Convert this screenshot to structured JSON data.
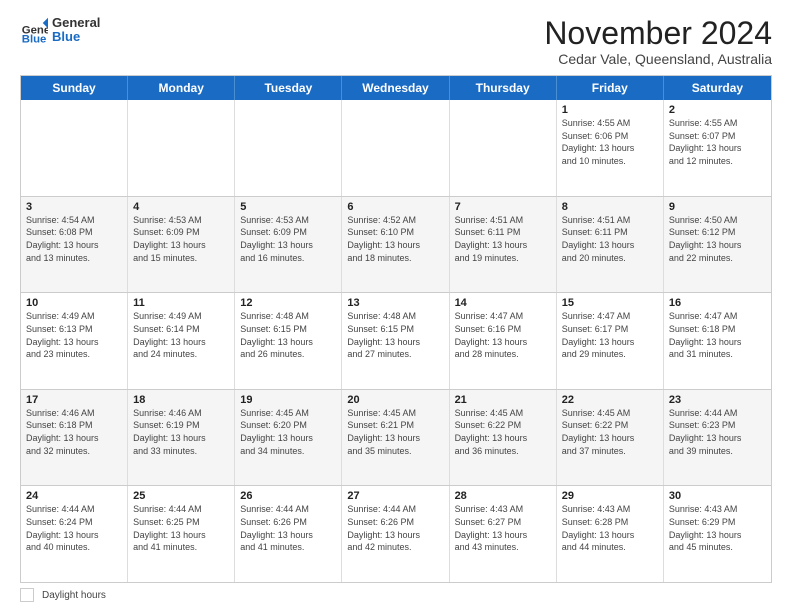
{
  "header": {
    "logo_general": "General",
    "logo_blue": "Blue",
    "title": "November 2024",
    "subtitle": "Cedar Vale, Queensland, Australia"
  },
  "calendar": {
    "days_of_week": [
      "Sunday",
      "Monday",
      "Tuesday",
      "Wednesday",
      "Thursday",
      "Friday",
      "Saturday"
    ],
    "rows": [
      {
        "alt": false,
        "cells": [
          {
            "day": "",
            "info": ""
          },
          {
            "day": "",
            "info": ""
          },
          {
            "day": "",
            "info": ""
          },
          {
            "day": "",
            "info": ""
          },
          {
            "day": "",
            "info": ""
          },
          {
            "day": "1",
            "info": "Sunrise: 4:55 AM\nSunset: 6:06 PM\nDaylight: 13 hours\nand 10 minutes."
          },
          {
            "day": "2",
            "info": "Sunrise: 4:55 AM\nSunset: 6:07 PM\nDaylight: 13 hours\nand 12 minutes."
          }
        ]
      },
      {
        "alt": true,
        "cells": [
          {
            "day": "3",
            "info": "Sunrise: 4:54 AM\nSunset: 6:08 PM\nDaylight: 13 hours\nand 13 minutes."
          },
          {
            "day": "4",
            "info": "Sunrise: 4:53 AM\nSunset: 6:09 PM\nDaylight: 13 hours\nand 15 minutes."
          },
          {
            "day": "5",
            "info": "Sunrise: 4:53 AM\nSunset: 6:09 PM\nDaylight: 13 hours\nand 16 minutes."
          },
          {
            "day": "6",
            "info": "Sunrise: 4:52 AM\nSunset: 6:10 PM\nDaylight: 13 hours\nand 18 minutes."
          },
          {
            "day": "7",
            "info": "Sunrise: 4:51 AM\nSunset: 6:11 PM\nDaylight: 13 hours\nand 19 minutes."
          },
          {
            "day": "8",
            "info": "Sunrise: 4:51 AM\nSunset: 6:11 PM\nDaylight: 13 hours\nand 20 minutes."
          },
          {
            "day": "9",
            "info": "Sunrise: 4:50 AM\nSunset: 6:12 PM\nDaylight: 13 hours\nand 22 minutes."
          }
        ]
      },
      {
        "alt": false,
        "cells": [
          {
            "day": "10",
            "info": "Sunrise: 4:49 AM\nSunset: 6:13 PM\nDaylight: 13 hours\nand 23 minutes."
          },
          {
            "day": "11",
            "info": "Sunrise: 4:49 AM\nSunset: 6:14 PM\nDaylight: 13 hours\nand 24 minutes."
          },
          {
            "day": "12",
            "info": "Sunrise: 4:48 AM\nSunset: 6:15 PM\nDaylight: 13 hours\nand 26 minutes."
          },
          {
            "day": "13",
            "info": "Sunrise: 4:48 AM\nSunset: 6:15 PM\nDaylight: 13 hours\nand 27 minutes."
          },
          {
            "day": "14",
            "info": "Sunrise: 4:47 AM\nSunset: 6:16 PM\nDaylight: 13 hours\nand 28 minutes."
          },
          {
            "day": "15",
            "info": "Sunrise: 4:47 AM\nSunset: 6:17 PM\nDaylight: 13 hours\nand 29 minutes."
          },
          {
            "day": "16",
            "info": "Sunrise: 4:47 AM\nSunset: 6:18 PM\nDaylight: 13 hours\nand 31 minutes."
          }
        ]
      },
      {
        "alt": true,
        "cells": [
          {
            "day": "17",
            "info": "Sunrise: 4:46 AM\nSunset: 6:18 PM\nDaylight: 13 hours\nand 32 minutes."
          },
          {
            "day": "18",
            "info": "Sunrise: 4:46 AM\nSunset: 6:19 PM\nDaylight: 13 hours\nand 33 minutes."
          },
          {
            "day": "19",
            "info": "Sunrise: 4:45 AM\nSunset: 6:20 PM\nDaylight: 13 hours\nand 34 minutes."
          },
          {
            "day": "20",
            "info": "Sunrise: 4:45 AM\nSunset: 6:21 PM\nDaylight: 13 hours\nand 35 minutes."
          },
          {
            "day": "21",
            "info": "Sunrise: 4:45 AM\nSunset: 6:22 PM\nDaylight: 13 hours\nand 36 minutes."
          },
          {
            "day": "22",
            "info": "Sunrise: 4:45 AM\nSunset: 6:22 PM\nDaylight: 13 hours\nand 37 minutes."
          },
          {
            "day": "23",
            "info": "Sunrise: 4:44 AM\nSunset: 6:23 PM\nDaylight: 13 hours\nand 39 minutes."
          }
        ]
      },
      {
        "alt": false,
        "cells": [
          {
            "day": "24",
            "info": "Sunrise: 4:44 AM\nSunset: 6:24 PM\nDaylight: 13 hours\nand 40 minutes."
          },
          {
            "day": "25",
            "info": "Sunrise: 4:44 AM\nSunset: 6:25 PM\nDaylight: 13 hours\nand 41 minutes."
          },
          {
            "day": "26",
            "info": "Sunrise: 4:44 AM\nSunset: 6:26 PM\nDaylight: 13 hours\nand 41 minutes."
          },
          {
            "day": "27",
            "info": "Sunrise: 4:44 AM\nSunset: 6:26 PM\nDaylight: 13 hours\nand 42 minutes."
          },
          {
            "day": "28",
            "info": "Sunrise: 4:43 AM\nSunset: 6:27 PM\nDaylight: 13 hours\nand 43 minutes."
          },
          {
            "day": "29",
            "info": "Sunrise: 4:43 AM\nSunset: 6:28 PM\nDaylight: 13 hours\nand 44 minutes."
          },
          {
            "day": "30",
            "info": "Sunrise: 4:43 AM\nSunset: 6:29 PM\nDaylight: 13 hours\nand 45 minutes."
          }
        ]
      }
    ]
  },
  "legend": {
    "label": "Daylight hours"
  }
}
